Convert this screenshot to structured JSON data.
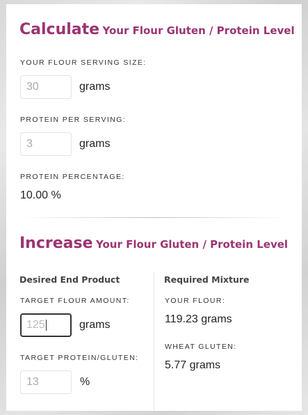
{
  "calculate": {
    "heading_big": "Calculate",
    "heading_small": "Your Flour Gluten / Protein Level",
    "serving_size_label": "YOUR FLOUR SERVING SIZE:",
    "serving_size_value": "30",
    "serving_size_unit": "grams",
    "protein_label": "PROTEIN PER SERVING:",
    "protein_value": "3",
    "protein_unit": "grams",
    "percentage_label": "PROTEIN PERCENTAGE:",
    "percentage_value": "10.00 %"
  },
  "increase": {
    "heading_big": "Increase",
    "heading_small": "Your Flour Gluten / Protein Level",
    "desired": {
      "title": "Desired End Product",
      "target_amount_label": "TARGET FLOUR AMOUNT:",
      "target_amount_value": "125",
      "target_amount_unit": "grams",
      "target_protein_label": "TARGET PROTEIN/GLUTEN:",
      "target_protein_value": "13",
      "target_protein_unit": "%"
    },
    "required": {
      "title": "Required Mixture",
      "your_flour_label": "YOUR FLOUR:",
      "your_flour_value": "119.23 grams",
      "wheat_gluten_label": "WHEAT GLUTEN:",
      "wheat_gluten_value": "5.77 grams"
    }
  },
  "colors": {
    "accent": "#9b3472"
  }
}
